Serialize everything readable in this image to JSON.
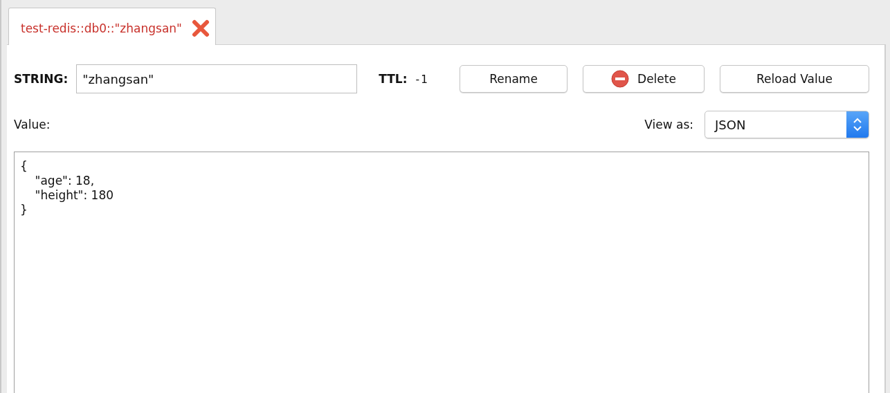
{
  "tabs": [
    {
      "label": "test-redis::db0::\"zhangsan\"",
      "selected": true
    }
  ],
  "key": {
    "type_label": "STRING:",
    "value": "\"zhangsan\"",
    "ttl_label": "TTL:",
    "ttl": "-1"
  },
  "buttons": [
    {
      "label": "Rename",
      "kind": "plain"
    },
    {
      "label": "Delete",
      "kind": "delete"
    },
    {
      "label": "Reload Value",
      "kind": "plain"
    }
  ],
  "value_label": "Value:",
  "view_as": {
    "label": "View as:",
    "value": "JSON"
  },
  "value_text": "{\n    \"age\": 18,\n    \"height\": 180\n}"
}
